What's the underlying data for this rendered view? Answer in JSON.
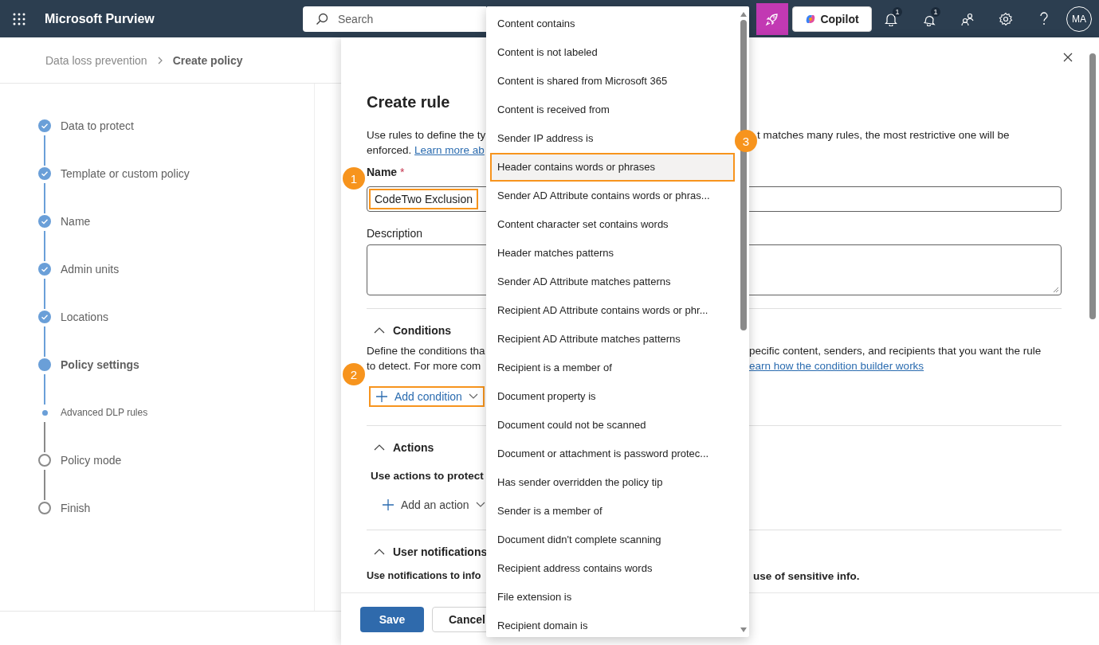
{
  "header": {
    "app_name": "Microsoft Purview",
    "search_placeholder": "Search",
    "copilot": "Copilot",
    "alerts": [
      {
        "count": "1"
      },
      {
        "count": "1"
      }
    ],
    "avatar": "MA"
  },
  "breadcrumb": [
    {
      "label": "Data loss prevention",
      "current": false
    },
    {
      "label": "Create policy",
      "current": true
    }
  ],
  "wizard_steps": [
    {
      "label": "Data to protect",
      "kind": "step",
      "completed": true,
      "current": false
    },
    {
      "label": "Template or custom policy",
      "kind": "step",
      "completed": true,
      "current": false
    },
    {
      "label": "Name",
      "kind": "step",
      "completed": true,
      "current": false
    },
    {
      "label": "Admin units",
      "kind": "step",
      "completed": true,
      "current": false
    },
    {
      "label": "Locations",
      "kind": "step",
      "completed": true,
      "current": false
    },
    {
      "label": "Policy settings",
      "kind": "step",
      "completed": false,
      "current": true
    },
    {
      "label": "Advanced DLP rules",
      "kind": "substep",
      "completed": false,
      "current": true
    },
    {
      "label": "Policy mode",
      "kind": "step",
      "completed": false,
      "current": false
    },
    {
      "label": "Finish",
      "kind": "step",
      "completed": false,
      "current": false
    }
  ],
  "panel": {
    "title": "Create rule",
    "intro": {
      "line_1_left": "Use rules to define the ty",
      "line_1_right": "t matches many rules, the most restrictive one will be",
      "line_2_left": "enforced.",
      "line_2_link": "Learn more ab"
    },
    "name_field": {
      "label": "Name",
      "required_mark": "*",
      "value": "CodeTwo Exclusion",
      "highlighted": true
    },
    "description_field": {
      "label": "Description"
    },
    "conditions": {
      "title": "Conditions",
      "expanded": true,
      "line_1_left": "Define the conditions tha",
      "line_1_right": "pecific content, senders, and recipients that you want the rule",
      "line_2_left": "to detect. For more com",
      "line_2_link": "earn how the condition builder works",
      "add_button": {
        "label": "Add condition",
        "highlighted": true
      }
    },
    "actions": {
      "title": "Actions",
      "expanded": true,
      "text": "Use actions to protect",
      "add_button": {
        "label": "Add an action",
        "highlighted": false
      }
    },
    "notifications": {
      "title": "User notifications",
      "expanded": true,
      "text_left": "Use notifications to info",
      "text_right": "use of sensitive info."
    },
    "buttons": [
      {
        "label": "Save",
        "kind": "primary"
      },
      {
        "label": "Cancel",
        "kind": "secondary"
      }
    ]
  },
  "dropdown": {
    "items": [
      {
        "label": "Content contains",
        "highlighted": false
      },
      {
        "label": "Content is not labeled",
        "highlighted": false
      },
      {
        "label": "Content is shared from Microsoft 365",
        "highlighted": false
      },
      {
        "label": "Content is received from",
        "highlighted": false
      },
      {
        "label": "Sender IP address is",
        "highlighted": false
      },
      {
        "label": "Header contains words or phrases",
        "highlighted": true
      },
      {
        "label": "Sender AD Attribute contains words or phras...",
        "highlighted": false
      },
      {
        "label": "Content character set contains words",
        "highlighted": false
      },
      {
        "label": "Header matches patterns",
        "highlighted": false
      },
      {
        "label": "Sender AD Attribute matches patterns",
        "highlighted": false
      },
      {
        "label": "Recipient AD Attribute contains words or phr...",
        "highlighted": false
      },
      {
        "label": "Recipient AD Attribute matches patterns",
        "highlighted": false
      },
      {
        "label": "Recipient is a member of",
        "highlighted": false
      },
      {
        "label": "Document property is",
        "highlighted": false
      },
      {
        "label": "Document could not be scanned",
        "highlighted": false
      },
      {
        "label": "Document or attachment is password protec...",
        "highlighted": false
      },
      {
        "label": "Has sender overridden the policy tip",
        "highlighted": false
      },
      {
        "label": "Sender is a member of",
        "highlighted": false
      },
      {
        "label": "Document didn't complete scanning",
        "highlighted": false
      },
      {
        "label": "Recipient address contains words",
        "highlighted": false
      },
      {
        "label": "File extension is",
        "highlighted": false
      },
      {
        "label": "Recipient domain is",
        "highlighted": false
      }
    ]
  },
  "annotations": [
    {
      "number": "1"
    },
    {
      "number": "2"
    },
    {
      "number": "3"
    }
  ]
}
